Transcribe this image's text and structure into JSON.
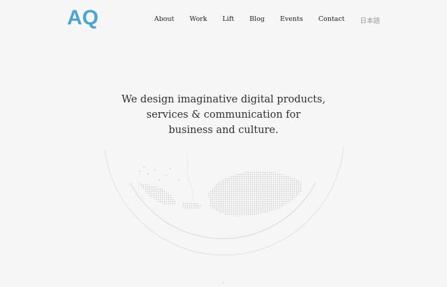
{
  "header": {
    "logo": "AQ",
    "nav": [
      {
        "label": "About"
      },
      {
        "label": "Work"
      },
      {
        "label": "Lift"
      },
      {
        "label": "Blog"
      },
      {
        "label": "Events"
      },
      {
        "label": "Contact"
      },
      {
        "label": "日本語"
      }
    ]
  },
  "hero": {
    "lines": [
      "We design imaginative digital products,",
      "services & communication for",
      "business and culture."
    ]
  },
  "colors": {
    "accent": "#4fa3cf",
    "background": "#f6f6f6",
    "text": "#2f2f2f"
  },
  "icons": [
    "globe-illustration"
  ]
}
